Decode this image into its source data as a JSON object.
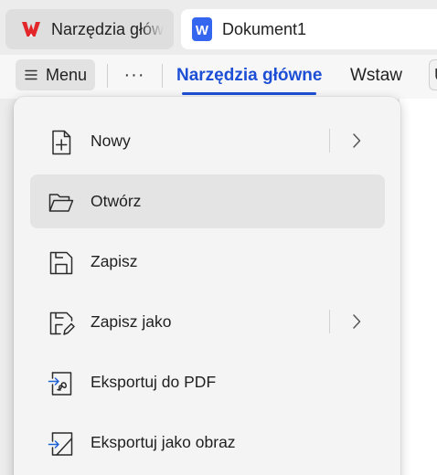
{
  "tabs": [
    {
      "label": "Narzędzia głów",
      "icon": "wps-logo-icon",
      "active": false
    },
    {
      "label": "Dokument1",
      "icon": "writer-doc-icon",
      "icon_letter": "W",
      "active": true
    }
  ],
  "ribbon": {
    "menu_label": "Menu",
    "more_label": "···",
    "tabs": [
      "Narzędzia główne",
      "Wstaw",
      "U"
    ],
    "active_tab": "Narzędzia główne"
  },
  "menu": {
    "items": [
      {
        "label": "Nowy",
        "icon": "new-file-icon",
        "submenu": true
      },
      {
        "label": "Otwórz",
        "icon": "folder-open-icon",
        "submenu": false,
        "hovered": true
      },
      {
        "label": "Zapisz",
        "icon": "save-icon",
        "submenu": false
      },
      {
        "label": "Zapisz jako",
        "icon": "save-as-icon",
        "submenu": true
      },
      {
        "label": "Eksportuj do PDF",
        "icon": "export-pdf-icon",
        "submenu": false
      },
      {
        "label": "Eksportuj jako obraz",
        "icon": "export-image-icon",
        "submenu": false
      }
    ]
  },
  "colors": {
    "accent": "#1d4fd6",
    "wps_red": "#e3262a",
    "writer_blue": "#3566f0",
    "export_blue": "#1e63d6"
  }
}
